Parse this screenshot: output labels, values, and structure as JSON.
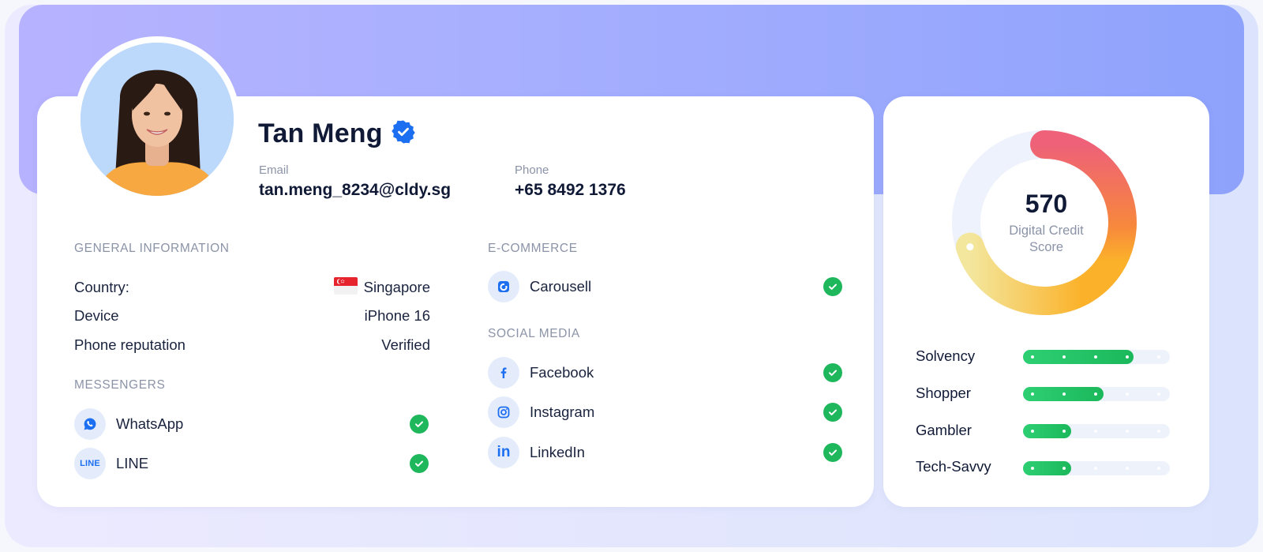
{
  "profile": {
    "name": "Tan Meng",
    "email_label": "Email",
    "email": "tan.meng_8234@cldy.sg",
    "phone_label": "Phone",
    "phone": "+65 8492 1376"
  },
  "general": {
    "title": "GENERAL INFORMATION",
    "rows": [
      {
        "label": "Country:",
        "value": "Singapore"
      },
      {
        "label": "Device",
        "value": "iPhone 16"
      },
      {
        "label": "Phone reputation",
        "value": "Verified"
      }
    ]
  },
  "messengers": {
    "title": "MESSENGERS",
    "items": [
      {
        "label": "WhatsApp",
        "icon": "whatsapp-icon",
        "icon_text": ""
      },
      {
        "label": "LINE",
        "icon": "line-icon",
        "icon_text": "LINE"
      }
    ]
  },
  "ecommerce": {
    "title": "E-COMMERCE",
    "items": [
      {
        "label": "Carousell",
        "icon": "carousell-icon"
      }
    ]
  },
  "social": {
    "title": "SOCIAL MEDIA",
    "items": [
      {
        "label": "Facebook",
        "icon": "facebook-icon"
      },
      {
        "label": "Instagram",
        "icon": "instagram-icon"
      },
      {
        "label": "LinkedIn",
        "icon": "linkedin-icon",
        "icon_text": "in"
      }
    ]
  },
  "score": {
    "value": "570",
    "caption_line1": "Digital Credit",
    "caption_line2": "Score",
    "fraction": 0.7
  },
  "traits": [
    {
      "label": "Solvency",
      "level": 0.75
    },
    {
      "label": "Shopper",
      "level": 0.55
    },
    {
      "label": "Gambler",
      "level": 0.33
    },
    {
      "label": "Tech-Savvy",
      "level": 0.33
    }
  ],
  "colors": {
    "accent_blue": "#1d6ff2",
    "check_green": "#1fb75c",
    "bar_green": "#22c267",
    "gauge_start": "#ee6178",
    "gauge_mid": "#f8962f",
    "gauge_end": "#f3e79e"
  }
}
